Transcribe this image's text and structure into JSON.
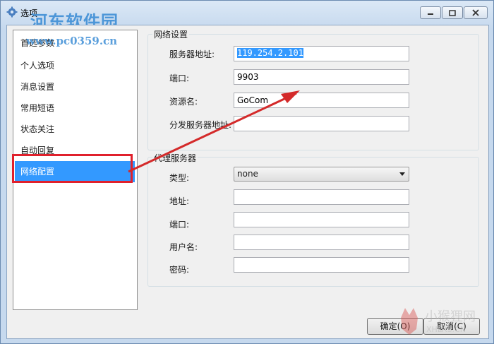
{
  "window": {
    "title": "选项",
    "watermark_title": "河东软件园",
    "watermark_url": "www.pc0359.cn"
  },
  "sidebar": {
    "items": [
      {
        "label": "首选参数"
      },
      {
        "label": "个人选项"
      },
      {
        "label": "消息设置"
      },
      {
        "label": "常用短语"
      },
      {
        "label": "状态关注"
      },
      {
        "label": "自动回复"
      },
      {
        "label": "网络配置",
        "selected": true
      }
    ]
  },
  "network": {
    "group_title": "网络设置",
    "server_label": "服务器地址:",
    "server_value": "119.254.2.101",
    "port_label": "端口:",
    "port_value": "9903",
    "resource_label": "资源名:",
    "resource_value": "GoCom",
    "dist_label": "分发服务器地址:",
    "dist_value": ""
  },
  "proxy": {
    "group_title": "代理服务器",
    "type_label": "类型:",
    "type_value": "none",
    "address_label": "地址:",
    "address_value": "",
    "port_label": "端口:",
    "port_value": "",
    "user_label": "用户名:",
    "user_value": "",
    "password_label": "密码:",
    "password_value": ""
  },
  "buttons": {
    "ok": "确定(O)",
    "cancel": "取消(C)"
  },
  "logo_watermark": {
    "text_cn": "小猴狸网",
    "text_en": "XHLRS.CN"
  },
  "colors": {
    "selection": "#3399ff",
    "highlight_box": "#e0202c",
    "arrow": "#d42a2a"
  }
}
